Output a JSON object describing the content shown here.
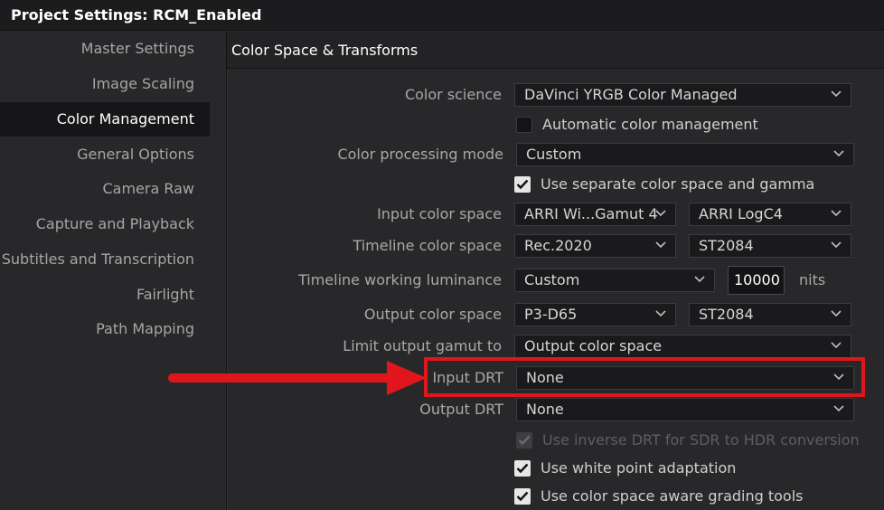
{
  "window": {
    "title": "Project Settings:  RCM_Enabled"
  },
  "sidebar": {
    "items": [
      {
        "label": "Master Settings"
      },
      {
        "label": "Image Scaling"
      },
      {
        "label": "Color Management",
        "active": true
      },
      {
        "label": "General Options"
      },
      {
        "label": "Camera Raw"
      },
      {
        "label": "Capture and Playback"
      },
      {
        "label": "Subtitles and Transcription"
      },
      {
        "label": "Fairlight"
      },
      {
        "label": "Path Mapping"
      }
    ]
  },
  "section": {
    "title": "Color Space & Transforms"
  },
  "form": {
    "color_science": {
      "label": "Color science",
      "value": "DaVinci YRGB Color Managed"
    },
    "auto_color_mgmt": {
      "label": "Automatic color management",
      "checked": false
    },
    "processing_mode": {
      "label": "Color processing mode",
      "value": "Custom"
    },
    "separate_gamma": {
      "label": "Use separate color space and gamma",
      "checked": true
    },
    "input_color_space": {
      "label": "Input color space",
      "space": "ARRI Wi...Gamut 4",
      "gamma": "ARRI LogC4"
    },
    "timeline_color_space": {
      "label": "Timeline color space",
      "space": "Rec.2020",
      "gamma": "ST2084"
    },
    "timeline_luminance": {
      "label": "Timeline working luminance",
      "value": "Custom",
      "nits_value": "10000",
      "nits_unit": "nits"
    },
    "output_color_space": {
      "label": "Output color space",
      "space": "P3-D65",
      "gamma": "ST2084"
    },
    "limit_gamut": {
      "label": "Limit output gamut to",
      "value": "Output color space"
    },
    "input_drt": {
      "label": "Input DRT",
      "value": "None"
    },
    "output_drt": {
      "label": "Output DRT",
      "value": "None"
    },
    "inverse_drt": {
      "label": "Use inverse DRT for SDR to HDR conversion",
      "checked": true,
      "disabled": true
    },
    "white_point": {
      "label": "Use white point adaptation",
      "checked": true
    },
    "space_aware": {
      "label": "Use color space aware grading tools",
      "checked": true
    }
  },
  "annotation": {
    "color": "#e0161c"
  }
}
